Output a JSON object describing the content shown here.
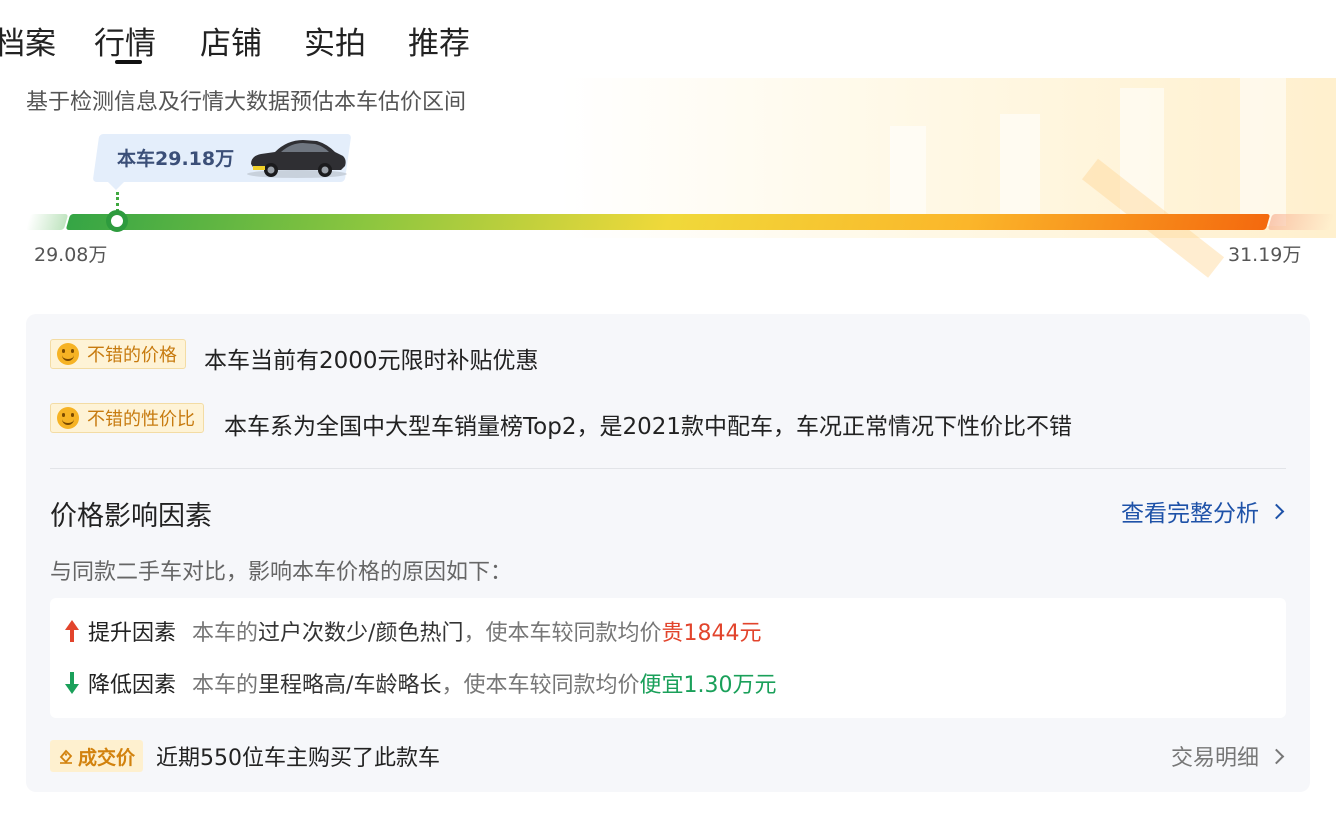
{
  "tabs": [
    {
      "label": "档案"
    },
    {
      "label": "行情",
      "active": true
    },
    {
      "label": "店铺"
    },
    {
      "label": "实拍"
    },
    {
      "label": "推荐"
    }
  ],
  "estimate": {
    "subtitle": "基于检测信息及行情大数据预估本车估价区间",
    "car_price_label": "本车29.18万",
    "range_low": "29.08万",
    "range_high": "31.19万",
    "car_position_fraction": 0.047,
    "icons": [
      "car-thumbnail-icon"
    ],
    "colors": {
      "bar_start": "#35a545",
      "bar_mid": "#f0d93a",
      "bar_end": "#f4690e"
    }
  },
  "highlights": [
    {
      "badge": "不错的价格",
      "text": "本车当前有2000元限时补贴优惠",
      "icon": "smile-icon"
    },
    {
      "badge": "不错的性价比",
      "text": "本车系为全国中大型车销量榜Top2，是2021款中配车，车况正常情况下性价比不错",
      "icon": "smile-icon"
    }
  ],
  "factors": {
    "title": "价格影响因素",
    "link_label": "查看完整分析",
    "note": "与同款二手车对比，影响本车价格的原因如下：",
    "rise": {
      "label": "提升因素",
      "prefix": "本车的",
      "reason": "过户次数少/颜色热门",
      "middle": "，使本车较同款均价",
      "effect": "贵1844元"
    },
    "drop": {
      "label": "降低因素",
      "prefix": "本车的",
      "reason": "里程略高/车龄略长",
      "middle": "，使本车较同款均价",
      "effect": "便宜1.30万元"
    }
  },
  "deal": {
    "badge": "成交价",
    "text": "近期550位车主购买了此款车",
    "link_label": "交易明细"
  }
}
